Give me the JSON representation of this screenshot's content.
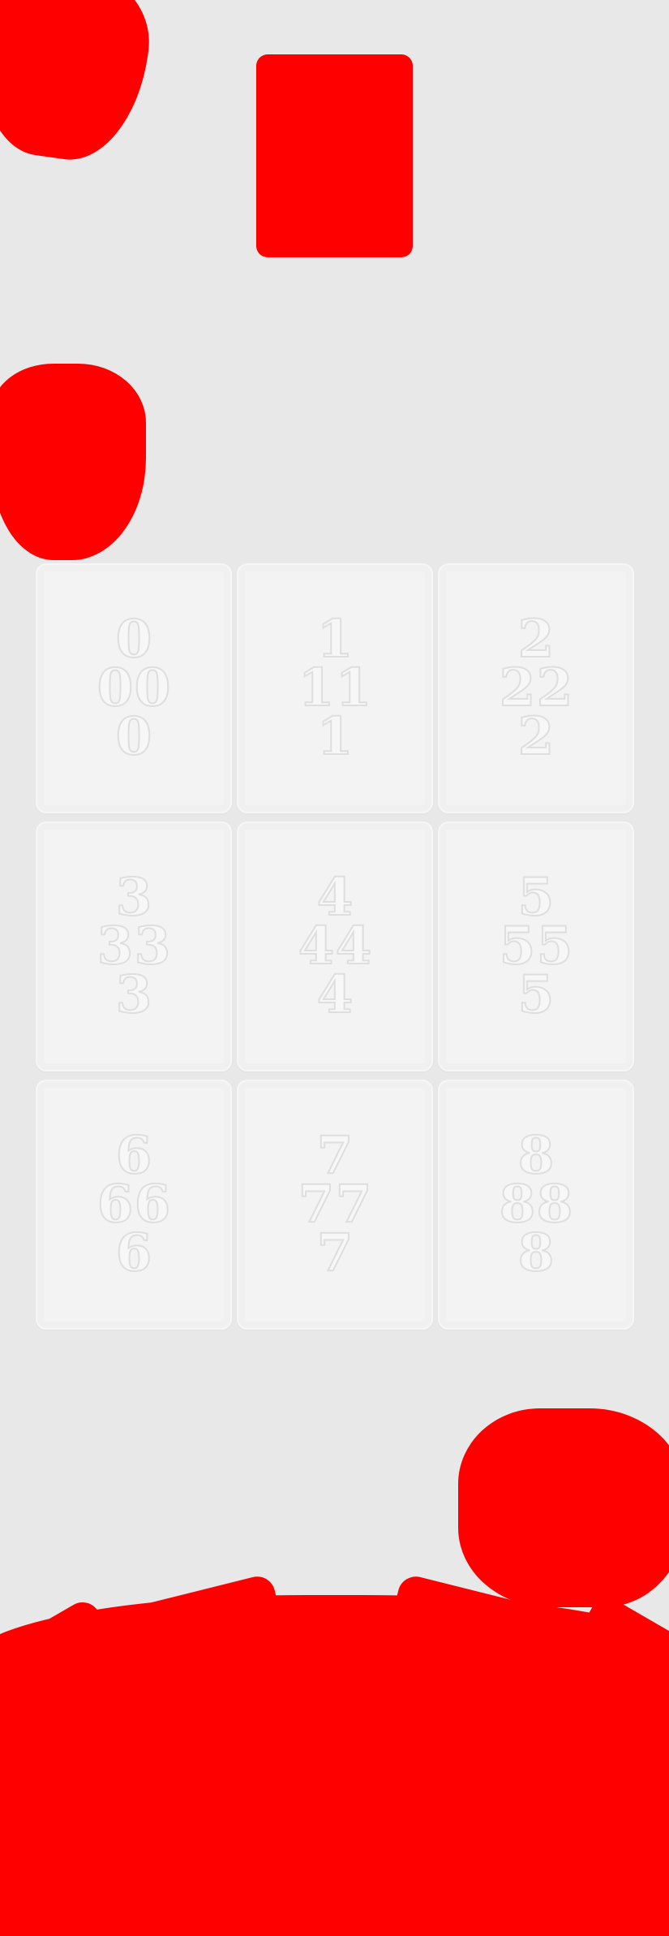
{
  "grid": {
    "cards": [
      {
        "digit": "0"
      },
      {
        "digit": "1"
      },
      {
        "digit": "2"
      },
      {
        "digit": "3"
      },
      {
        "digit": "4"
      },
      {
        "digit": "5"
      },
      {
        "digit": "6"
      },
      {
        "digit": "7"
      },
      {
        "digit": "8"
      }
    ]
  },
  "colors": {
    "background": "#e8e8e8",
    "card": "#f3f3f3",
    "redaction": "#ff0000",
    "pip_outline": "#dedede"
  }
}
